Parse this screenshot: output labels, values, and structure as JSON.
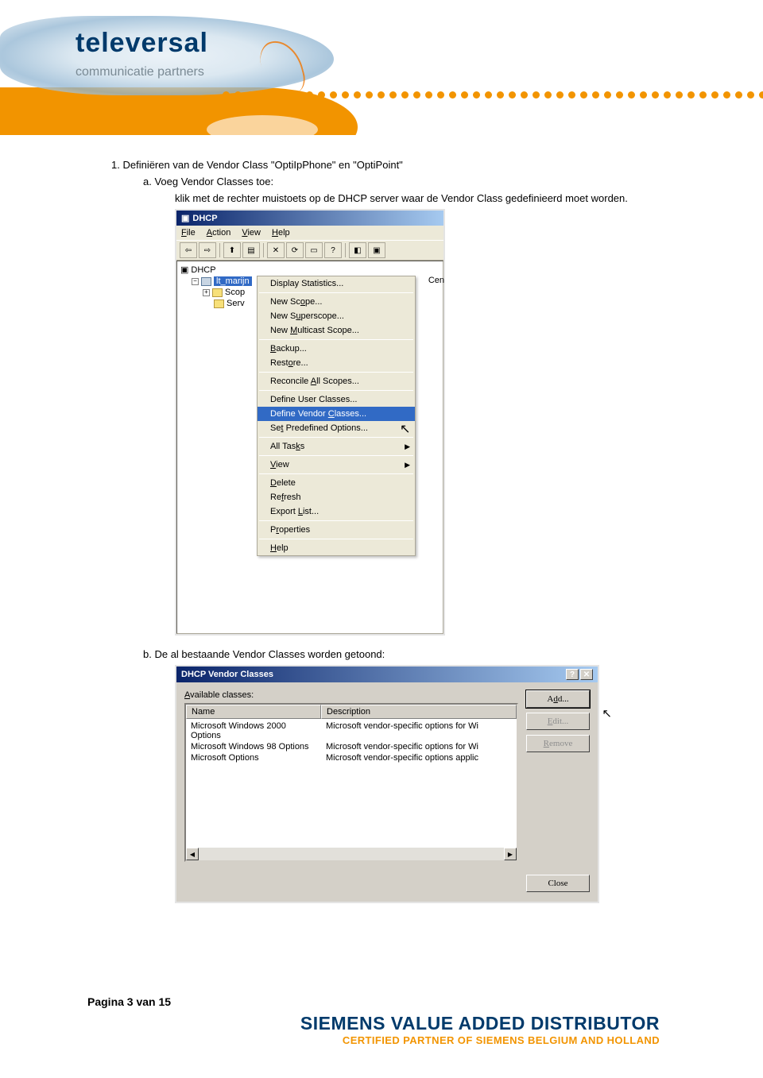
{
  "header": {
    "logo": "televersal",
    "logo_sub": "communicatie partners"
  },
  "content": {
    "section_number": "1.",
    "section_title": "Definiëren van de Vendor Class \"OptiIpPhone\" en \"OptiPoint\"",
    "sub_a_letter": "a.",
    "sub_a_title": "Voeg Vendor Classes toe:",
    "sub_a_text": "klik met de rechter muistoets op de DHCP server waar de Vendor Class gedefinieerd moet worden.",
    "sub_b_letter": "b.",
    "sub_b_text": "De al bestaande Vendor Classes worden getoond:"
  },
  "screenshot1": {
    "title": "DHCP",
    "menus": {
      "file": "File",
      "action": "Action",
      "view": "View",
      "help": "Help"
    },
    "tree": {
      "root": "DHCP",
      "server": "lt_marijn",
      "scope": "Scop",
      "options": "Serv",
      "right_clip": "Cen"
    },
    "ctx": {
      "display_statistics": "Display Statistics...",
      "new_scope": "New Scope...",
      "new_superscope": "New Superscope...",
      "new_multicast": "New Multicast Scope...",
      "backup": "Backup...",
      "restore": "Restore...",
      "reconcile": "Reconcile All Scopes...",
      "define_user": "Define User Classes...",
      "define_vendor": "Define Vendor Classes...",
      "set_predefined": "Set Predefined Options...",
      "all_tasks": "All Tasks",
      "view": "View",
      "delete": "Delete",
      "refresh": "Refresh",
      "export_list": "Export List...",
      "properties": "Properties",
      "help": "Help"
    }
  },
  "screenshot2": {
    "title": "DHCP Vendor Classes",
    "available_label": "Available classes:",
    "col_name": "Name",
    "col_desc": "Description",
    "rows": [
      {
        "name": "Microsoft Windows 2000 Options",
        "desc": "Microsoft vendor-specific options for Wi"
      },
      {
        "name": "Microsoft Windows 98 Options",
        "desc": "Microsoft vendor-specific options for Wi"
      },
      {
        "name": "Microsoft Options",
        "desc": "Microsoft vendor-specific options applic"
      }
    ],
    "buttons": {
      "add": "Add...",
      "edit": "Edit...",
      "remove": "Remove",
      "close": "Close"
    }
  },
  "footer": {
    "page": "Pagina 3 van 15",
    "siemens1": "SIEMENS VALUE ADDED DISTRIBUTOR",
    "siemens2": "CERTIFIED PARTNER OF SIEMENS BELGIUM AND HOLLAND"
  }
}
